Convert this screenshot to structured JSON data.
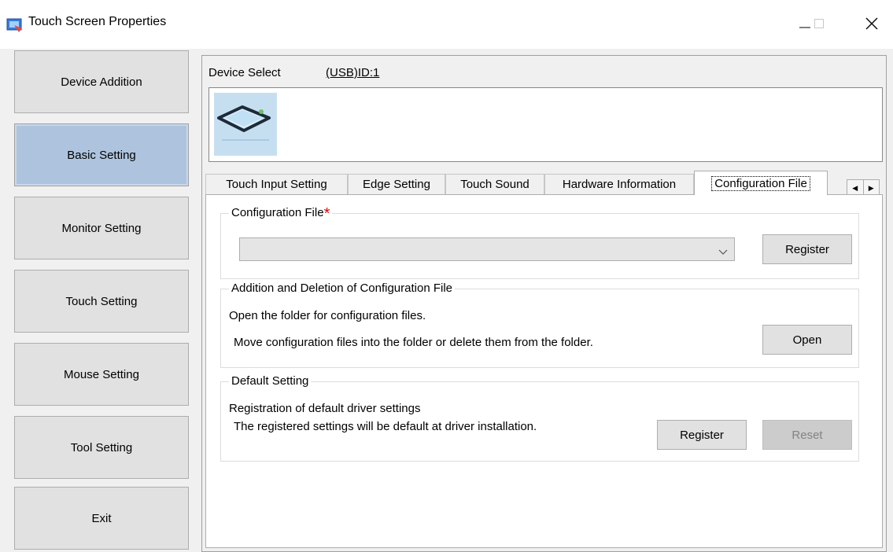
{
  "window": {
    "title": "Touch Screen Properties",
    "minimize_icon": "minimize-icon",
    "maximize_icon": "maximize-icon",
    "close_icon": "close-icon"
  },
  "nav": {
    "items": [
      {
        "label": "Device Addition",
        "active": false
      },
      {
        "label": "Basic Setting",
        "active": true
      },
      {
        "label": "Monitor Setting",
        "active": false
      },
      {
        "label": "Touch Setting",
        "active": false
      },
      {
        "label": "Mouse Setting",
        "active": false
      },
      {
        "label": "Tool Setting",
        "active": false
      },
      {
        "label": "Exit",
        "active": false
      }
    ]
  },
  "device": {
    "select_label": "Device Select",
    "id_label": "(USB)ID:1",
    "thumbnail_icon": "touch-panel-icon"
  },
  "tabs": {
    "items": [
      {
        "label": "Touch Input Setting"
      },
      {
        "label": "Edge Setting"
      },
      {
        "label": "Touch Sound"
      },
      {
        "label": "Hardware Information"
      },
      {
        "label": "Configuration File"
      }
    ],
    "selected": "Configuration File"
  },
  "config_file": {
    "legend": "Configuration File",
    "required_mark": "*",
    "dropdown_value": "",
    "register_label": "Register"
  },
  "add_delete": {
    "legend": "Addition and Deletion of Configuration File",
    "line1": "Open the folder for configuration files.",
    "line2": "Move configuration files into the folder or delete them from the folder.",
    "open_label": "Open"
  },
  "default_setting": {
    "legend": "Default Setting",
    "line1": "Registration of default driver settings",
    "line2": "The registered settings will be default at driver installation.",
    "register_label": "Register",
    "reset_label": "Reset"
  },
  "colors": {
    "active_nav": "#aec4de",
    "required_star": "#e00000"
  }
}
